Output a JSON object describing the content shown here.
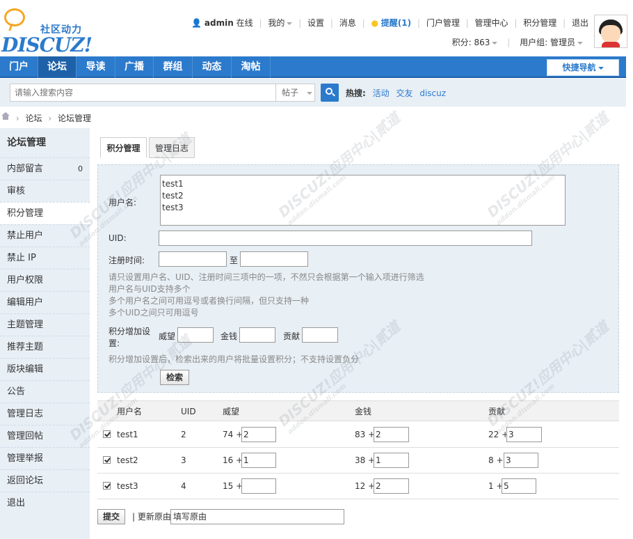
{
  "logo": {
    "cn": "社区动力",
    "en": "DISCUZ!"
  },
  "top_links": {
    "username": "admin",
    "status": "在线",
    "mine": "我的",
    "settings": "设置",
    "messages": "消息",
    "remind": "提醒(1)",
    "portal_manage": "门户管理",
    "admin_center": "管理中心",
    "credit_manage": "积分管理",
    "logout": "退出"
  },
  "user_info": {
    "credits": "积分: 863",
    "group": "用户组: 管理员"
  },
  "nav": {
    "items": [
      "门户",
      "论坛",
      "导读",
      "广播",
      "群组",
      "动态",
      "淘帖"
    ],
    "active_index": 1,
    "quick_nav": "快捷导航"
  },
  "search": {
    "placeholder": "请输入搜索内容",
    "type": "帖子",
    "hot_label": "热搜:",
    "hot_links": [
      "活动",
      "交友",
      "discuz"
    ]
  },
  "breadcrumb": [
    "论坛",
    "论坛管理"
  ],
  "sidebar": {
    "title": "论坛管理",
    "items": [
      {
        "label": "内部留言",
        "count": "0"
      },
      {
        "label": "审核"
      },
      {
        "label": "积分管理",
        "active": true
      },
      {
        "label": "禁止用户"
      },
      {
        "label": "禁止 IP"
      },
      {
        "label": "用户权限"
      },
      {
        "label": "编辑用户"
      },
      {
        "label": "主题管理"
      },
      {
        "label": "推荐主题"
      },
      {
        "label": "版块编辑"
      },
      {
        "label": "公告"
      },
      {
        "label": "管理日志"
      },
      {
        "label": "管理回帖"
      },
      {
        "label": "管理举报"
      },
      {
        "label": "返回论坛"
      },
      {
        "label": "退出"
      }
    ]
  },
  "tabs": [
    "积分管理",
    "管理日志"
  ],
  "filter": {
    "username_label": "用户名:",
    "usernames": [
      "test1",
      "test2",
      "test3"
    ],
    "uid_label": "UID:",
    "regtime_label": "注册时间:",
    "to_label": "至",
    "hints": [
      "请只设置用户名、UID、注册时间三项中的一项，不然只会根据第一个输入项进行筛选",
      "用户名与UID支持多个",
      "多个用户名之间可用逗号或者换行间隔，但只支持一种",
      "多个UID之间只可用逗号"
    ],
    "credit_setting_label_1": "积分增加设",
    "credit_setting_label_2": "置:",
    "credit_names": [
      "威望",
      "金钱",
      "贡献"
    ],
    "credit_hint": "积分增加设置后，检索出来的用户将批量设置积分；不支持设置负分",
    "search_button": "检索"
  },
  "table": {
    "headers": [
      "用户名",
      "UID",
      "威望",
      "金钱",
      "贡献"
    ],
    "rows": [
      {
        "username": "test1",
        "uid": "2",
        "prestige": "74 +",
        "prestige_add": "2",
        "money": "83 +",
        "money_add": "2",
        "contrib": "22 +",
        "contrib_add": "3"
      },
      {
        "username": "test2",
        "uid": "3",
        "prestige": "16 +",
        "prestige_add": "1",
        "money": "38 +",
        "money_add": "1",
        "contrib": "8 +",
        "contrib_add": "3"
      },
      {
        "username": "test3",
        "uid": "4",
        "prestige": "15 +",
        "prestige_add": "",
        "money": "12 +",
        "money_add": "2",
        "contrib": "1 +",
        "contrib_add": "5"
      }
    ]
  },
  "submit": {
    "button": "提交",
    "reason_label": "| 更新原由",
    "reason_value": "填写原由"
  },
  "watermark": {
    "main": "DISCUZ!应用中心|贰道",
    "sub": "addon.dismall.com"
  },
  "colors": {
    "brand": "#2b7acc",
    "nav_active": "#1f61a8",
    "panel_bg": "#e8eff5",
    "logo_bubble": "#f6a623"
  }
}
